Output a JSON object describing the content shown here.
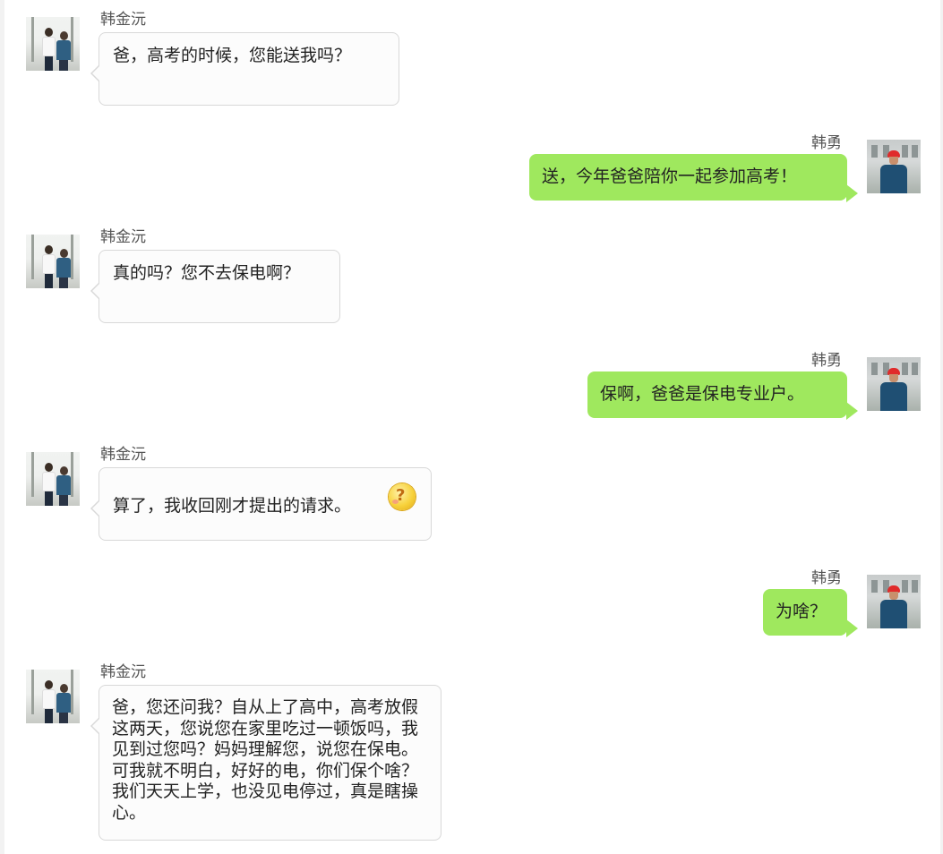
{
  "chat": {
    "participants": {
      "son": {
        "name": "韩金沅",
        "avatar": "son-with-father-photo"
      },
      "dad": {
        "name": "韩勇",
        "avatar": "worker-red-helmet-photo"
      }
    },
    "messages": [
      {
        "sender": "韩金沅",
        "side": "left",
        "text": "爸，高考的时候，您能送我吗？"
      },
      {
        "sender": "韩勇",
        "side": "right",
        "text": "送，今年爸爸陪你一起参加高考！"
      },
      {
        "sender": "韩金沅",
        "side": "left",
        "text": "真的吗？您不去保电啊？"
      },
      {
        "sender": "韩勇",
        "side": "right",
        "text": "保啊，爸爸是保电专业户。"
      },
      {
        "sender": "韩金沅",
        "side": "left",
        "text": "算了，我收回刚才提出的请求。",
        "emoji": "confused-question-emoji"
      },
      {
        "sender": "韩勇",
        "side": "right",
        "text": "为啥？"
      },
      {
        "sender": "韩金沅",
        "side": "left",
        "text": "爸，您还问我？自从上了高中，高考放假这两天，您说您在家里吃过一顿饭吗，我见到过您吗？妈妈理解您，说您在保电。可我就不明白，好好的电，你们保个啥？我们天天上学，也没见电停过，真是瞎操心。"
      }
    ]
  },
  "colors": {
    "outgoing_bubble": "#9fe85e",
    "incoming_bubble": "#fcfcfc",
    "incoming_border": "#d8d8d8"
  }
}
